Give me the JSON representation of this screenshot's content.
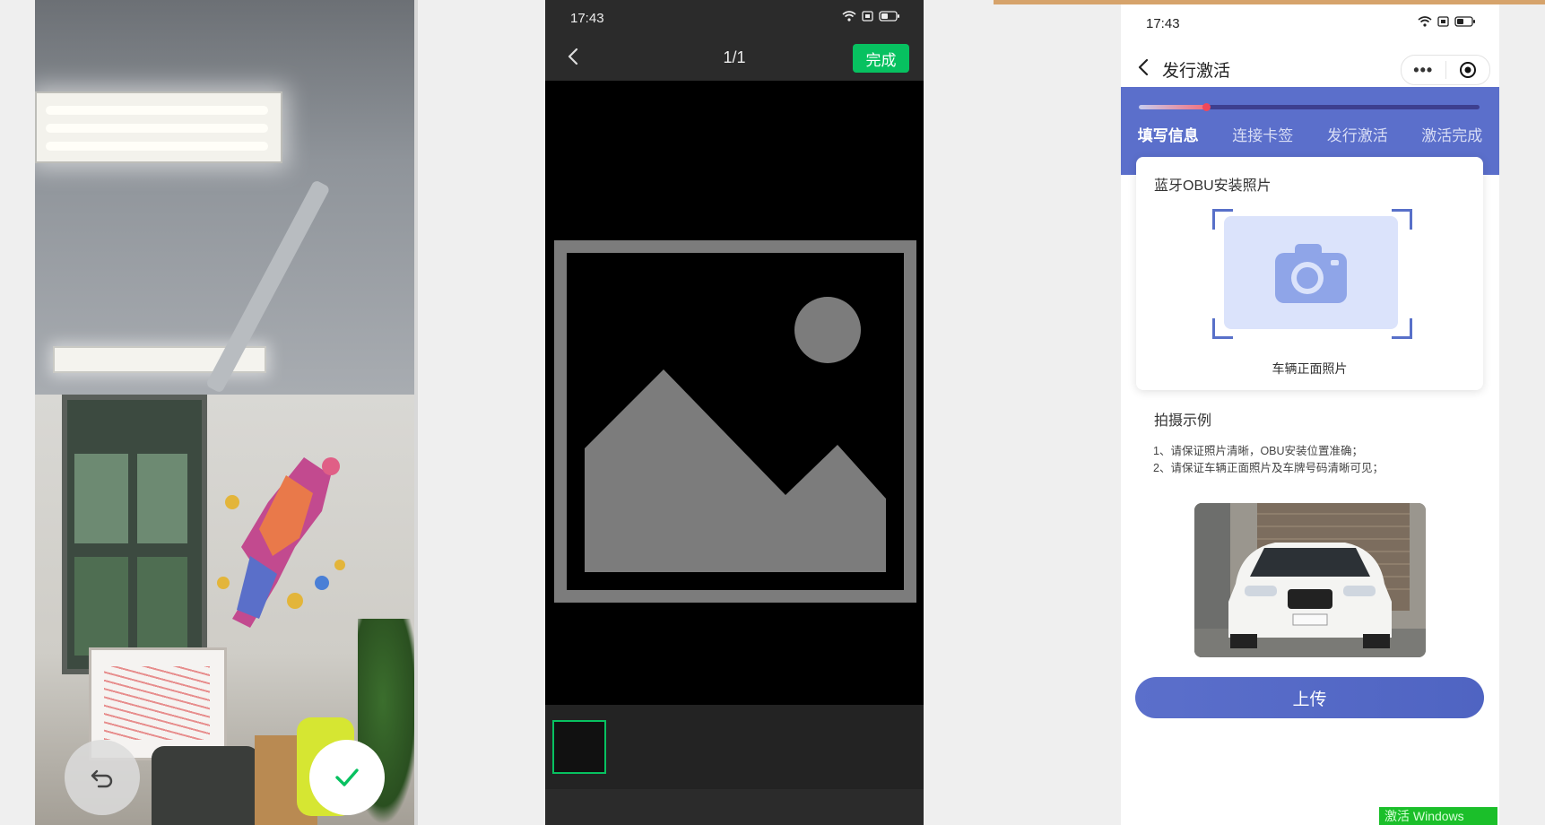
{
  "camera": {
    "undo_icon": "undo-icon",
    "confirm_icon": "check-icon",
    "accent": "#07c160"
  },
  "preview": {
    "status_time": "17:43",
    "counter": "1/1",
    "done_label": "完成",
    "accent": "#07c160",
    "placeholder_icon": "image-placeholder-icon"
  },
  "miniprogram": {
    "status_time": "17:43",
    "title": "发行激活",
    "capsule_more": "•••",
    "progress": 0.2,
    "steps": [
      "填写信息",
      "连接卡签",
      "发行激活",
      "激活完成"
    ],
    "active_step": 0,
    "card_title": "蓝牙OBU安装照片",
    "camera_caption": "车辆正面照片",
    "example_title": "拍摄示例",
    "example_notes": [
      "1、请保证照片清晰，OBU安装位置准确；",
      "2、请保证车辆正面照片及车牌号码清晰可见；"
    ],
    "upload_label": "上传",
    "brand_color": "#5b6fcb"
  },
  "watermark": "激活 Windows"
}
